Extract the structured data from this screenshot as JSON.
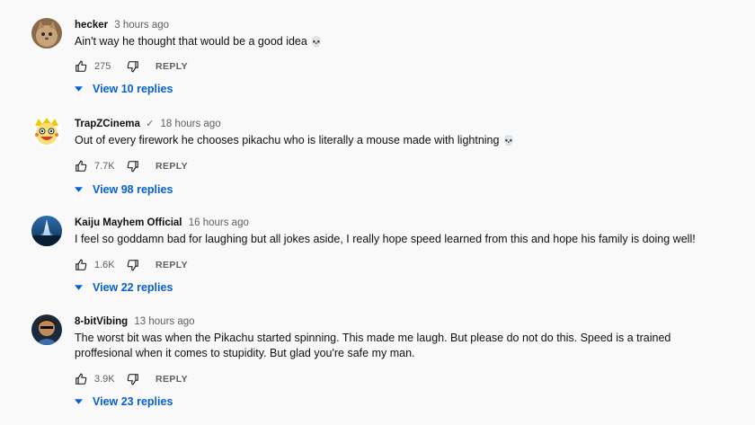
{
  "comments": [
    {
      "author": "hecker",
      "verified": "",
      "time": "3 hours ago",
      "text": "Ain't way he thought that would be a good idea",
      "emoji": "💀",
      "likes": "275",
      "reply_label": "REPLY",
      "view_replies": "View 10 replies",
      "avatar_icon": "cat-avatar-icon"
    },
    {
      "author": "TrapZCinema",
      "verified": "✓",
      "time": "18 hours ago",
      "text": "Out of every firework he chooses pikachu who is literally a mouse made with lightning",
      "emoji": "💀",
      "likes": "7.7K",
      "reply_label": "REPLY",
      "view_replies": "View 98 replies",
      "avatar_icon": "cartoon-face-avatar-icon"
    },
    {
      "author": "Kaiju Mayhem Official",
      "verified": "",
      "time": "16 hours ago",
      "text": "I feel so goddamn bad for laughing but all jokes aside, I really hope speed learned from this and hope his family is doing well!",
      "emoji": "",
      "likes": "1.6K",
      "reply_label": "REPLY",
      "view_replies": "View 22 replies",
      "avatar_icon": "monster-avatar-icon"
    },
    {
      "author": "8-bitVibing",
      "verified": "",
      "time": "13 hours ago",
      "text": "The worst bit was when the Pikachu started spinning. This made me laugh. But please do not do this. Speed is a trained proffesional when it comes to stupidity. But glad you're safe my man.",
      "emoji": "",
      "likes": "3.9K",
      "reply_label": "REPLY",
      "view_replies": "View 23 replies",
      "avatar_icon": "person-avatar-icon"
    }
  ],
  "colors": {
    "background": "#f9f9f9",
    "link_blue": "#065fd4",
    "secondary_text": "#606060"
  }
}
